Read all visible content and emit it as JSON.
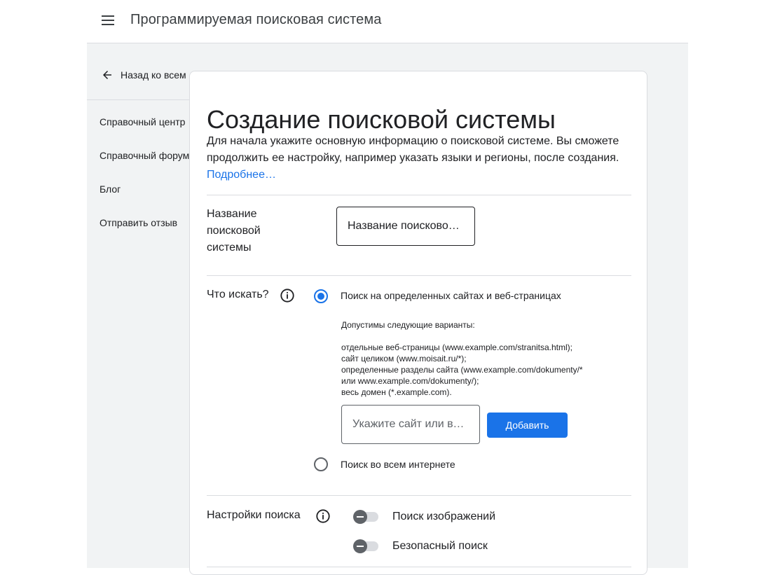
{
  "header": {
    "app_title": "Программируемая поисковая система"
  },
  "sidebar": {
    "back_label": "Назад ко всем",
    "items": [
      {
        "label": "Справочный центр"
      },
      {
        "label": "Справочный форум"
      },
      {
        "label": "Блог"
      },
      {
        "label": "Отправить отзыв"
      }
    ]
  },
  "form": {
    "title": "Создание поисковой системы",
    "intro": "Для начала укажите основную информацию о поисковой системе. Вы сможете продолжить ее настройку, например указать языки и регионы, после создания.",
    "learn_more": "Подробнее…",
    "name_field": {
      "label": "Название поисковой системы",
      "value": "Название поисковой системы"
    },
    "what_to_search": {
      "label": "Что искать?",
      "option_sites": "Поиск на определенных сайтах и веб-страницах",
      "option_sites_selected": true,
      "hint_title": "Допустимы следующие варианты:",
      "hint_lines": [
        "отдельные веб-страницы (www.example.com/stranitsa.html);",
        "сайт целиком (www.moisait.ru/*);",
        "определенные разделы сайта (www.example.com/dokumenty/*",
        "или www.example.com/dokumenty/);",
        "весь домен (*.example.com)."
      ],
      "site_placeholder": "Укажите сайт или веб-страницу",
      "add_button": "Добавить",
      "option_web": "Поиск во всем интернете"
    },
    "search_settings": {
      "label": "Настройки поиска",
      "image_search": "Поиск изображений",
      "image_search_on": false,
      "safe_search": "Безопасный поиск",
      "safe_search_on": false
    }
  },
  "colors": {
    "accent": "#1a73e8",
    "canvas": "#f1f3f4",
    "divider": "#dadce0"
  }
}
